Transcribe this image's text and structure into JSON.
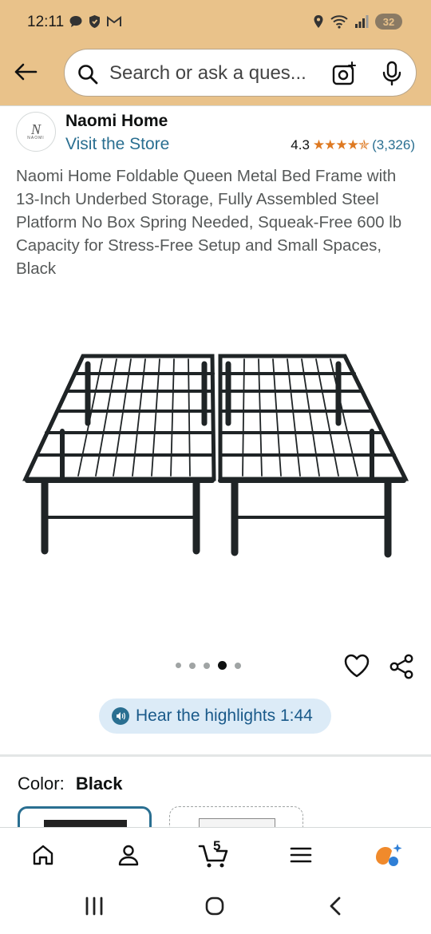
{
  "status_bar": {
    "time": "12:11",
    "battery": "32"
  },
  "search": {
    "placeholder": "Search or ask a ques..."
  },
  "store": {
    "logo_mark": "N",
    "logo_text": "NAOMI",
    "name": "Naomi Home",
    "visit_label": "Visit the Store",
    "rating": "4.3",
    "stars": "★★★★✯",
    "rating_count": "(3,326)"
  },
  "product": {
    "title": "Naomi Home Foldable Queen Metal Bed Frame with 13-Inch Underbed Storage, Fully Assembled Steel Platform No Box Spring Needed, Squeak-Free 600 lb Capacity for Stress-Free Setup and Small Spaces, Black",
    "image_count": 5,
    "active_image_index": 3
  },
  "audio": {
    "label": "Hear the highlights 1:44"
  },
  "variant": {
    "color_label": "Color:",
    "color_value": "Black"
  },
  "cart": {
    "count": "5"
  },
  "colors": {
    "header_bg": "#e9c28a",
    "link": "#2a6f91",
    "star": "#de7921",
    "pill_bg": "#dcebf7"
  },
  "icons": {
    "back": "arrow-left-icon",
    "search": "search-icon",
    "camera": "camera-lens-icon",
    "mic": "microphone-icon",
    "wishlist": "heart-icon",
    "share": "share-icon",
    "home": "home-icon",
    "account": "person-icon",
    "cart": "cart-icon",
    "menu": "hamburger-menu-icon",
    "rufus": "rufus-ai-icon"
  }
}
